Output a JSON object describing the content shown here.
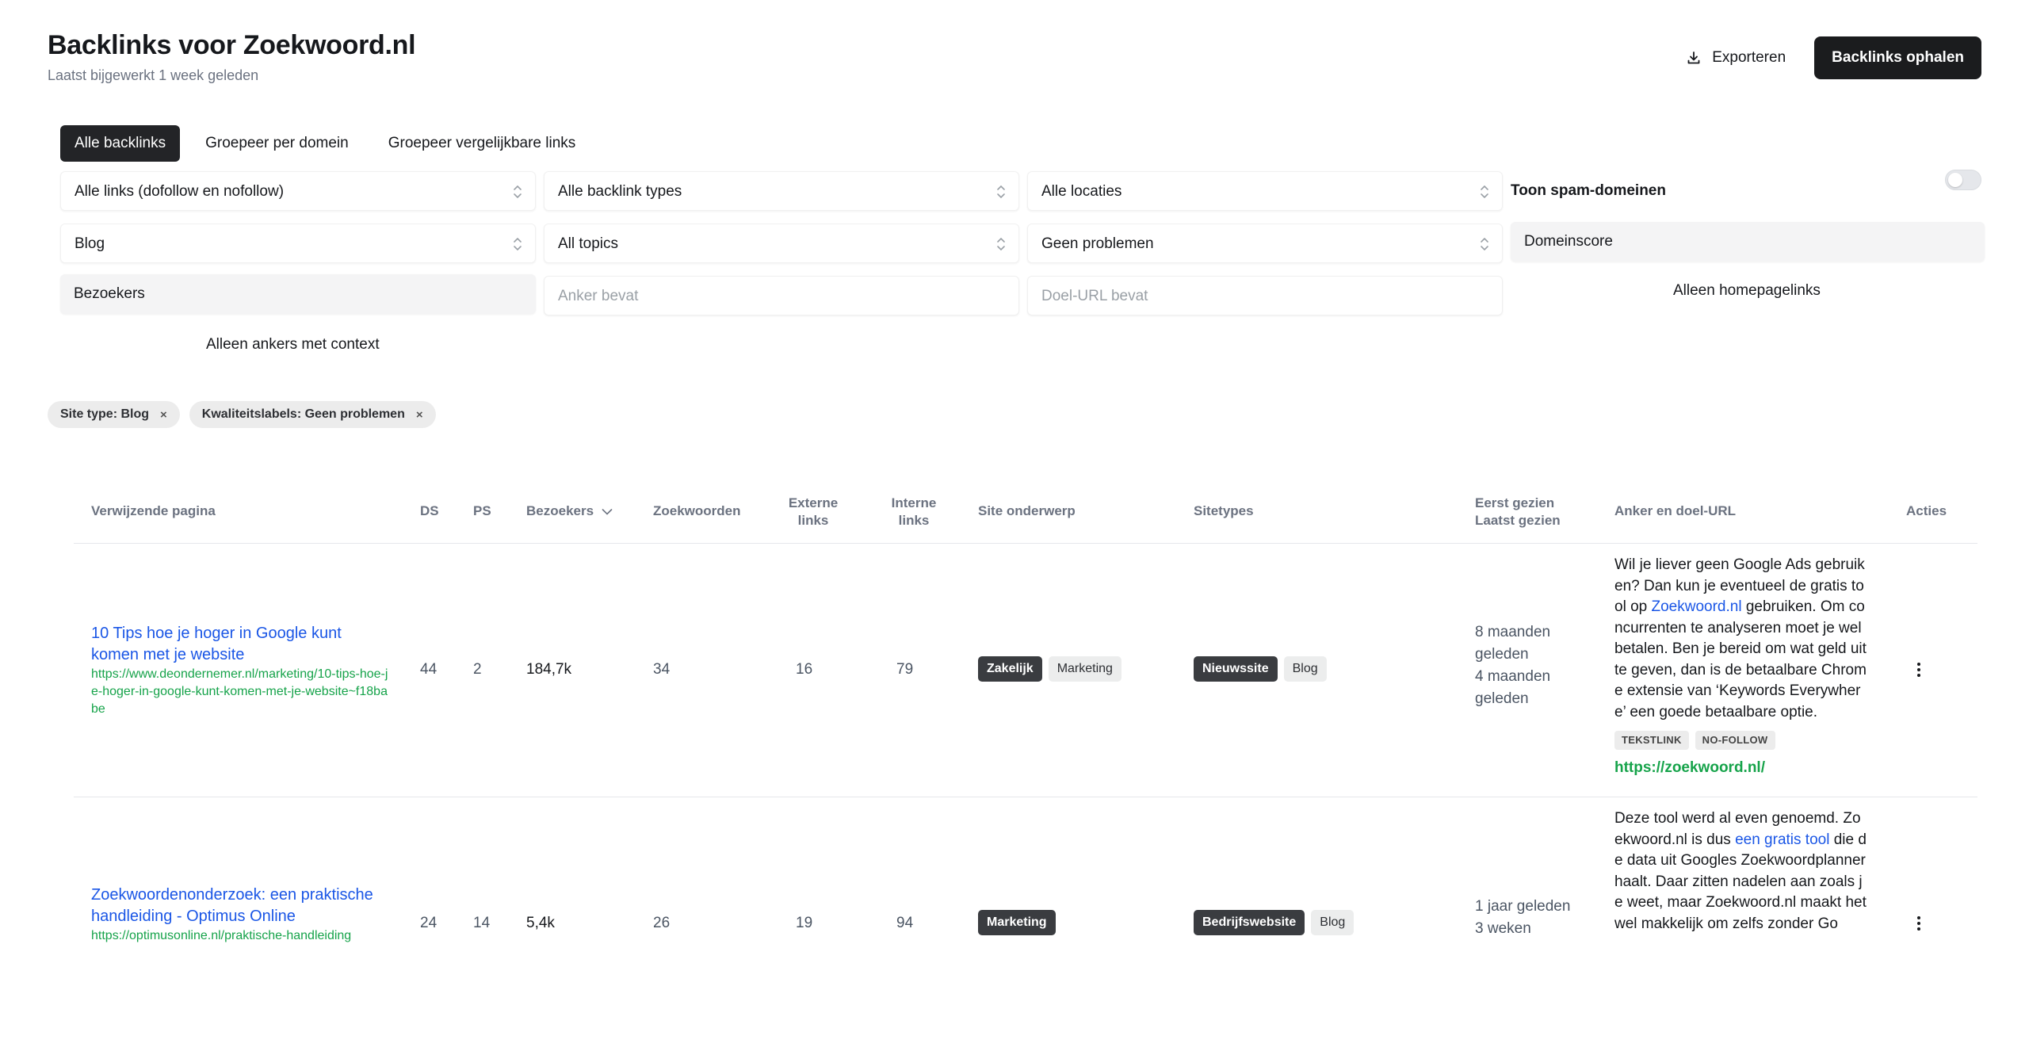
{
  "header": {
    "title": "Backlinks voor Zoekwoord.nl",
    "subtitle": "Laatst bijgewerkt 1 week geleden",
    "export_label": "Exporteren",
    "primary_label": "Backlinks ophalen"
  },
  "tabs": [
    {
      "label": "Alle backlinks",
      "active": true
    },
    {
      "label": "Groepeer per domein",
      "active": false
    },
    {
      "label": "Groepeer vergelijkbare links",
      "active": false
    }
  ],
  "filters": {
    "link_type": "Alle links (dofollow en nofollow)",
    "backlink_types": "Alle backlink types",
    "locations": "Alle locaties",
    "spam_label": "Toon spam-domeinen",
    "site_type": "Blog",
    "topics": "All topics",
    "quality": "Geen problemen",
    "domain_score": "Domeinscore",
    "visitors": "Bezoekers",
    "anchor_placeholder": "Anker bevat",
    "target_placeholder": "Doel-URL bevat",
    "homepage_only": "Alleen homepagelinks",
    "context_only": "Alleen ankers met context"
  },
  "chips": [
    {
      "label": "Site type: Blog",
      "remove": "×"
    },
    {
      "label": "Kwaliteitslabels: Geen problemen",
      "remove": "×"
    }
  ],
  "table": {
    "headers": {
      "page": "Verwijzende pagina",
      "ds": "DS",
      "ps": "PS",
      "visitors": "Bezoekers",
      "keywords": "Zoekwoorden",
      "external_1": "Externe",
      "external_2": "links",
      "internal_1": "Interne",
      "internal_2": "links",
      "topic": "Site onderwerp",
      "sitetypes": "Sitetypes",
      "first_seen": "Eerst gezien",
      "last_seen": "Laatst gezien",
      "anchor": "Anker en doel-URL",
      "actions": "Acties"
    },
    "rows": [
      {
        "title": "10 Tips hoe je hoger in Google kunt komen met je website",
        "url": "https://www.deondernemer.nl/marketing/10-tips-hoe-je-hoger-in-google-kunt-komen-met-je-website~f18babe",
        "ds": "44",
        "ps": "2",
        "visitors": "184,7k",
        "keywords": "34",
        "external": "16",
        "internal": "79",
        "topics": [
          {
            "label": "Zakelijk",
            "style": "dark"
          },
          {
            "label": "Marketing",
            "style": "light"
          }
        ],
        "sitetypes": [
          {
            "label": "Nieuwssite",
            "style": "dark"
          },
          {
            "label": "Blog",
            "style": "light"
          }
        ],
        "first_seen": "8 maanden geleden",
        "last_seen": "4 maanden geleden",
        "anchor_before": "Wil je liever geen Google Ads gebruiken? Dan kun je eventueel de gratis tool op ",
        "anchor_link": "Zoekwoord.nl",
        "anchor_after": " gebruiken. Om concurrenten te analyseren moet je wel betalen. Ben je bereid om wat geld uit te geven, dan is de betaalbare Chrome extensie van ‘Keywords Everywhere’ een goede betaalbare optie.",
        "tags": [
          "TEKSTLINK",
          "NO-FOLLOW"
        ],
        "target_url": "https://zoekwoord.nl/"
      },
      {
        "title": "Zoekwoordenonderzoek: een praktische handleiding - Optimus Online",
        "url": "https://optimusonline.nl/praktische-handleiding",
        "ds": "24",
        "ps": "14",
        "visitors": "5,4k",
        "keywords": "26",
        "external": "19",
        "internal": "94",
        "topics": [
          {
            "label": "Marketing",
            "style": "dark"
          }
        ],
        "sitetypes": [
          {
            "label": "Bedrijfswebsite",
            "style": "dark"
          },
          {
            "label": "Blog",
            "style": "light"
          }
        ],
        "first_seen": "1 jaar geleden",
        "last_seen": "3 weken",
        "anchor_before": "Deze tool werd al even genoemd. Zoekwoord.nl is dus ",
        "anchor_link": "een gratis tool",
        "anchor_after": " die de data uit Googles Zoekwoordplanner haalt. Daar zitten nadelen aan zoals je weet, maar Zoekwoord.nl maakt het wel makkelijk om zelfs zonder Go",
        "tags": [],
        "target_url": ""
      }
    ]
  },
  "icons": {
    "export": "download-icon",
    "select": "chevron-updown-icon",
    "sort": "chevron-down-icon",
    "actions": "more-vertical-icon"
  }
}
